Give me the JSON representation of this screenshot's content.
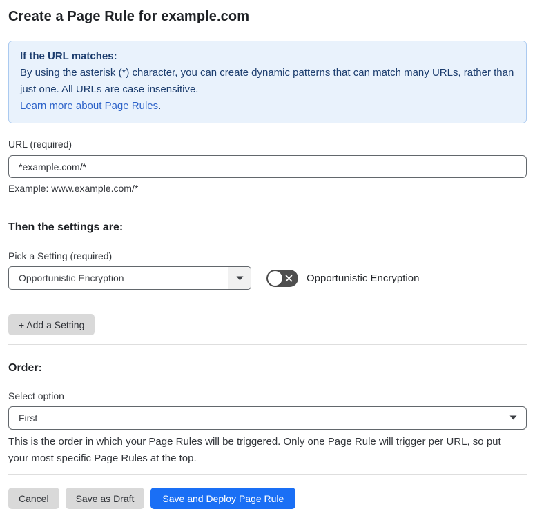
{
  "page": {
    "title": "Create a Page Rule for example.com"
  },
  "info_box": {
    "heading": "If the URL matches:",
    "body": "By using the asterisk (*) character, you can create dynamic patterns that can match many URLs, rather than just one. All URLs are case insensitive.",
    "link_label": "Learn more about Page Rules",
    "link_suffix": "."
  },
  "url_section": {
    "label": "URL (required)",
    "input_value": "*example.com/*",
    "helper": "Example: www.example.com/*"
  },
  "settings_section": {
    "heading": "Then the settings are:",
    "picker_label": "Pick a Setting (required)",
    "picker_value": "Opportunistic Encryption",
    "toggle_state": "off",
    "toggle_label": "Opportunistic Encryption",
    "add_button_label": "+ Add a Setting"
  },
  "order_section": {
    "heading": "Order:",
    "select_label": "Select option",
    "select_value": "First",
    "helper": "This is the order in which your Page Rules will be triggered. Only one Page Rule will trigger per URL, so put your most specific Page Rules at the top."
  },
  "footer": {
    "cancel_label": "Cancel",
    "save_draft_label": "Save as Draft",
    "save_deploy_label": "Save and Deploy Page Rule"
  },
  "colors": {
    "info_bg": "#e9f2fc",
    "info_border": "#abcaf0",
    "info_text": "#1c3d6e",
    "link": "#2c62c9",
    "primary_button": "#1a6ff5",
    "toggle_off": "#4e4e4e"
  }
}
